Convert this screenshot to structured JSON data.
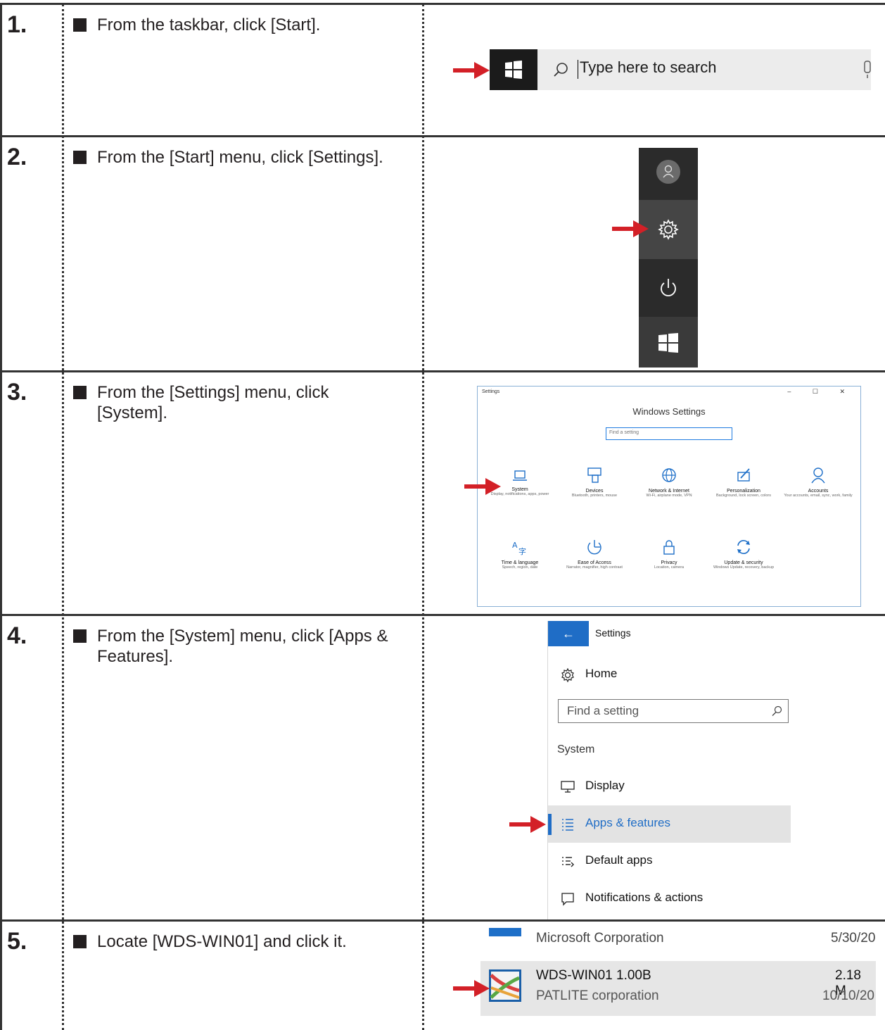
{
  "steps": [
    {
      "number": "1.",
      "instruction": "From the taskbar, click [Start]."
    },
    {
      "number": "2.",
      "instruction": "From the [Start] menu, click [Settings]."
    },
    {
      "number": "3.",
      "instruction": "From the [Settings] menu, click [System]."
    },
    {
      "number": "4.",
      "instruction": "From the [System] menu, click [Apps & Features]."
    },
    {
      "number": "5.",
      "instruction": "Locate [WDS-WIN01] and click it."
    }
  ],
  "taskbar": {
    "search_placeholder": "Type here to search",
    "icons": [
      "windows-logo-icon",
      "search-icon",
      "microphone-icon"
    ]
  },
  "start_menu": {
    "icons": [
      "user-icon",
      "gear-icon",
      "power-icon",
      "windows-logo-icon"
    ]
  },
  "settings_window": {
    "title": "Settings",
    "controls": "– ☐ ✕",
    "heading": "Windows Settings",
    "search_placeholder": "Find a setting",
    "tiles": [
      {
        "label": "System",
        "desc": "Display, notifications, apps, power",
        "icon": "laptop-icon"
      },
      {
        "label": "Devices",
        "desc": "Bluetooth, printers, mouse",
        "icon": "keyboard-icon"
      },
      {
        "label": "Network & Internet",
        "desc": "Wi-Fi, airplane mode, VPN",
        "icon": "globe-icon"
      },
      {
        "label": "Personalization",
        "desc": "Background, lock screen, colors",
        "icon": "brush-icon"
      },
      {
        "label": "Accounts",
        "desc": "Your accounts, email, sync, work, family",
        "icon": "person-icon"
      },
      {
        "label": "Time & language",
        "desc": "Speech, region, date",
        "icon": "language-icon"
      },
      {
        "label": "Ease of Access",
        "desc": "Narrator, magnifier, high contrast",
        "icon": "ease-icon"
      },
      {
        "label": "Privacy",
        "desc": "Location, camera",
        "icon": "lock-icon"
      },
      {
        "label": "Update & security",
        "desc": "Windows Update, recovery, backup",
        "icon": "refresh-icon"
      }
    ]
  },
  "system_menu": {
    "back": "←",
    "title": "Settings",
    "home": "Home",
    "search_placeholder": "Find a setting",
    "group": "System",
    "items": [
      {
        "label": "Display",
        "icon": "monitor-icon"
      },
      {
        "label": "Apps & features",
        "icon": "list-icon"
      },
      {
        "label": "Default apps",
        "icon": "default-apps-icon"
      },
      {
        "label": "Notifications & actions",
        "icon": "notification-icon"
      }
    ],
    "accent": "#1f6dc6"
  },
  "app_list": {
    "rows": [
      {
        "name": "Microsoft Corporation",
        "size": "",
        "date": "5/30/20"
      },
      {
        "name": "WDS-WIN01 1.00B",
        "publisher": "PATLITE corporation",
        "size": "2.18 M",
        "date": "10/10/20"
      }
    ]
  },
  "colors": {
    "arrow": "#d32027",
    "rule": "#333333"
  }
}
